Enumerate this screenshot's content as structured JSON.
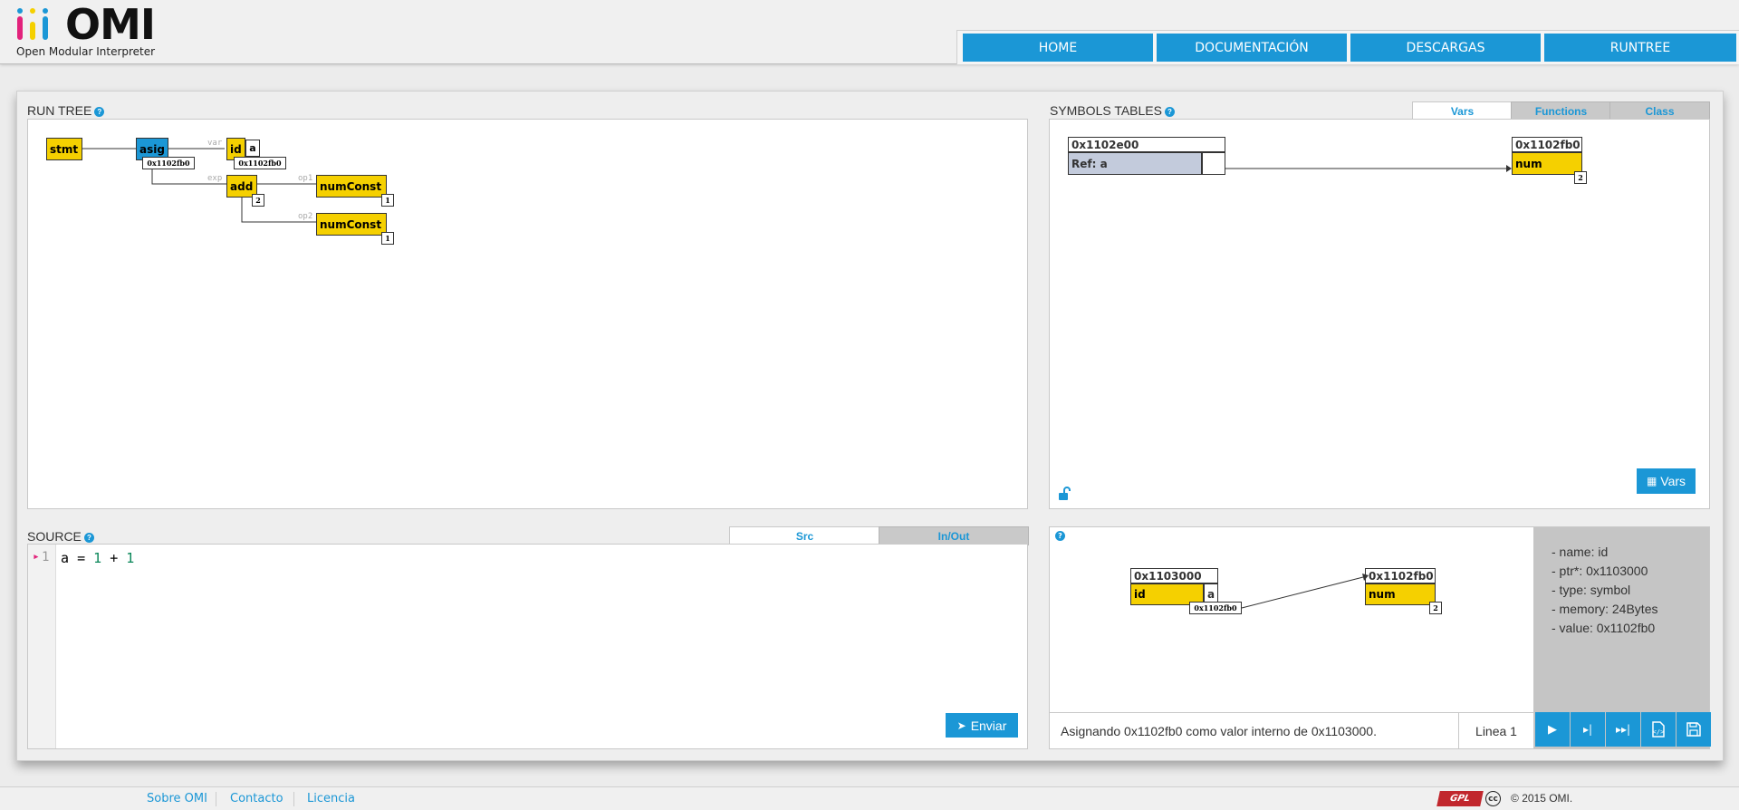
{
  "brand": {
    "name": "OMI",
    "subtitle": "Open Modular Interpreter"
  },
  "nav": {
    "items": [
      "HOME",
      "DOCUMENTACIÓN",
      "DESCARGAS",
      "RUNTREE"
    ]
  },
  "run_tree": {
    "title": "RUN TREE",
    "nodes": {
      "stmt": "stmt",
      "asig": "asig",
      "id": "id",
      "id_value": "a",
      "add": "add",
      "num1": "numConst",
      "num2": "numConst"
    },
    "tags": {
      "asig_addr": "0x1102fb0",
      "id_addr": "0x1102fb0",
      "add_val": "2",
      "num1_val": "1",
      "num2_val": "1"
    },
    "edge_labels": {
      "var": "var",
      "exp": "exp",
      "op1": "op1",
      "op2": "op2"
    }
  },
  "symbols": {
    "title": "SYMBOLS TABLES",
    "tabs": [
      "Vars",
      "Functions",
      "Class"
    ],
    "table_header": "0x1102e00",
    "ref_label": "Ref: a",
    "target_header": "0x1102fb0",
    "target_type": "num",
    "target_value": "2",
    "vars_button": "Vars"
  },
  "source": {
    "title": "SOURCE",
    "tabs": [
      "Src",
      "In/Out"
    ],
    "line_number": "1",
    "code_tokens": {
      "var": "a",
      "eq": "=",
      "n1": "1",
      "plus": "+",
      "n2": "1"
    },
    "send_button": "Enviar"
  },
  "inspector": {
    "box1_header": "0x1103000",
    "box1_type": "id",
    "box1_value": "a",
    "box1_tag": "0x1102fb0",
    "box2_header": "0x1102fb0",
    "box2_type": "num",
    "box2_value": "2",
    "props": [
      "- name: id",
      "- ptr*: 0x1103000",
      "- type: symbol",
      "- memory: 24Bytes",
      "- value: 0x1102fb0"
    ],
    "status": "Asignando 0x1102fb0 como valor interno de 0x1103000.",
    "line": "Linea 1"
  },
  "footer": {
    "links": [
      "Sobre OMI",
      "Contacto",
      "Licencia"
    ],
    "badges": {
      "gpl": "GPL",
      "cc": "cc"
    },
    "copyright": "2015 OMI."
  },
  "colors": {
    "accent": "#1b97d6",
    "node": "#f5d000",
    "node_active": "#1b97d6",
    "ref": "#c3cbdc",
    "logo": [
      "#e2227b",
      "#f5d000",
      "#1b97d6"
    ]
  }
}
